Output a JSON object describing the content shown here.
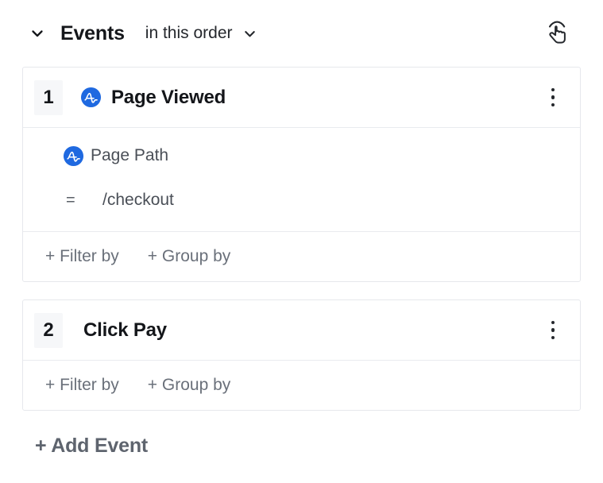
{
  "header": {
    "collapse_icon": "chevron-down-icon",
    "title": "Events",
    "order_label": "in this order",
    "order_chevron_icon": "chevron-down-icon",
    "gesture_icon": "tap-hand-icon"
  },
  "events": [
    {
      "number": "1",
      "icon": "amplitude-logo-icon",
      "name": "Page Viewed",
      "menu_icon": "kebab-menu-icon",
      "filters": [
        {
          "property_icon": "amplitude-logo-icon",
          "property_name": "Page Path",
          "operator": "=",
          "value": "/checkout"
        }
      ],
      "add_filter_label": "+ Filter by",
      "add_group_label": "+ Group by"
    },
    {
      "number": "2",
      "icon": null,
      "name": "Click Pay",
      "menu_icon": "kebab-menu-icon",
      "filters": [],
      "add_filter_label": "+ Filter by",
      "add_group_label": "+ Group by"
    }
  ],
  "footer": {
    "add_event_label": "+ Add Event"
  },
  "colors": {
    "amplitude_blue": "#1f69e0",
    "card_border": "#e6e8ec",
    "text_primary": "#14161a",
    "text_muted": "#6a707a"
  }
}
